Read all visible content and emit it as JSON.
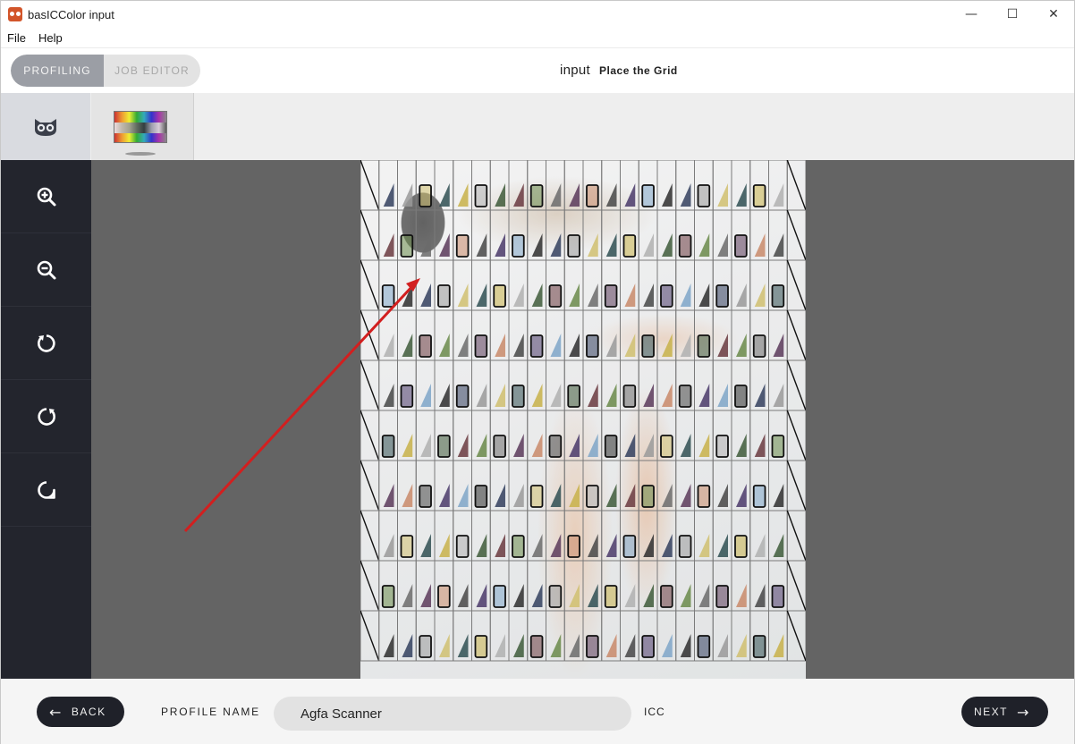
{
  "window": {
    "title": "basICColor input",
    "controls": {
      "minimize": "—",
      "maximize": "☐",
      "close": "✕"
    }
  },
  "menu": {
    "items": [
      "File",
      "Help"
    ]
  },
  "header": {
    "tabs": [
      {
        "label": "PROFILING",
        "active": true
      },
      {
        "label": "JOB EDITOR",
        "active": false
      }
    ],
    "app_label": "input",
    "step_label": "Place the Grid"
  },
  "thumbnails": [
    {
      "icon": "owl-icon",
      "selected": true
    },
    {
      "icon": "color-target-thumbnail",
      "selected": false
    }
  ],
  "tools": [
    {
      "name": "zoom-in-icon"
    },
    {
      "name": "zoom-out-icon"
    },
    {
      "name": "rotate-left-icon"
    },
    {
      "name": "rotate-right-icon"
    },
    {
      "name": "reset-view-icon"
    }
  ],
  "footer": {
    "back_label": "BACK",
    "next_label": "NEXT",
    "profile_name_label": "PROFILE NAME",
    "profile_name_value": "Agfa Scanner",
    "extension": "ICC"
  },
  "colors": {
    "toolbar_bg": "#23252d",
    "canvas_bg": "#646464",
    "segment_active": "#9b9ea5",
    "annotation_arrow": "#d21f1f",
    "button_dark": "#1f2129"
  }
}
